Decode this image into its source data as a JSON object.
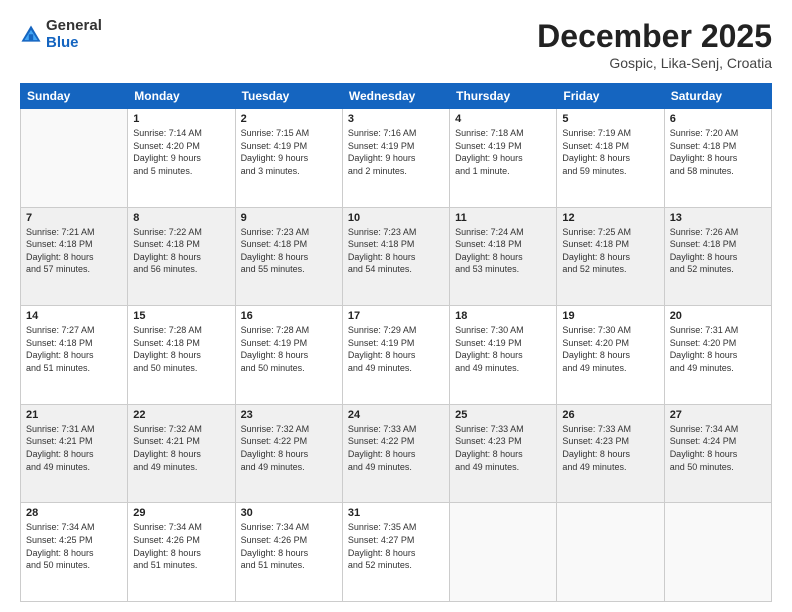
{
  "header": {
    "logo": {
      "general": "General",
      "blue": "Blue"
    },
    "title": "December 2025",
    "location": "Gospic, Lika-Senj, Croatia"
  },
  "weekdays": [
    "Sunday",
    "Monday",
    "Tuesday",
    "Wednesday",
    "Thursday",
    "Friday",
    "Saturday"
  ],
  "weeks": [
    [
      {
        "day": "",
        "info": ""
      },
      {
        "day": "1",
        "info": "Sunrise: 7:14 AM\nSunset: 4:20 PM\nDaylight: 9 hours\nand 5 minutes."
      },
      {
        "day": "2",
        "info": "Sunrise: 7:15 AM\nSunset: 4:19 PM\nDaylight: 9 hours\nand 3 minutes."
      },
      {
        "day": "3",
        "info": "Sunrise: 7:16 AM\nSunset: 4:19 PM\nDaylight: 9 hours\nand 2 minutes."
      },
      {
        "day": "4",
        "info": "Sunrise: 7:18 AM\nSunset: 4:19 PM\nDaylight: 9 hours\nand 1 minute."
      },
      {
        "day": "5",
        "info": "Sunrise: 7:19 AM\nSunset: 4:18 PM\nDaylight: 8 hours\nand 59 minutes."
      },
      {
        "day": "6",
        "info": "Sunrise: 7:20 AM\nSunset: 4:18 PM\nDaylight: 8 hours\nand 58 minutes."
      }
    ],
    [
      {
        "day": "7",
        "info": "Sunrise: 7:21 AM\nSunset: 4:18 PM\nDaylight: 8 hours\nand 57 minutes."
      },
      {
        "day": "8",
        "info": "Sunrise: 7:22 AM\nSunset: 4:18 PM\nDaylight: 8 hours\nand 56 minutes."
      },
      {
        "day": "9",
        "info": "Sunrise: 7:23 AM\nSunset: 4:18 PM\nDaylight: 8 hours\nand 55 minutes."
      },
      {
        "day": "10",
        "info": "Sunrise: 7:23 AM\nSunset: 4:18 PM\nDaylight: 8 hours\nand 54 minutes."
      },
      {
        "day": "11",
        "info": "Sunrise: 7:24 AM\nSunset: 4:18 PM\nDaylight: 8 hours\nand 53 minutes."
      },
      {
        "day": "12",
        "info": "Sunrise: 7:25 AM\nSunset: 4:18 PM\nDaylight: 8 hours\nand 52 minutes."
      },
      {
        "day": "13",
        "info": "Sunrise: 7:26 AM\nSunset: 4:18 PM\nDaylight: 8 hours\nand 52 minutes."
      }
    ],
    [
      {
        "day": "14",
        "info": "Sunrise: 7:27 AM\nSunset: 4:18 PM\nDaylight: 8 hours\nand 51 minutes."
      },
      {
        "day": "15",
        "info": "Sunrise: 7:28 AM\nSunset: 4:18 PM\nDaylight: 8 hours\nand 50 minutes."
      },
      {
        "day": "16",
        "info": "Sunrise: 7:28 AM\nSunset: 4:19 PM\nDaylight: 8 hours\nand 50 minutes."
      },
      {
        "day": "17",
        "info": "Sunrise: 7:29 AM\nSunset: 4:19 PM\nDaylight: 8 hours\nand 49 minutes."
      },
      {
        "day": "18",
        "info": "Sunrise: 7:30 AM\nSunset: 4:19 PM\nDaylight: 8 hours\nand 49 minutes."
      },
      {
        "day": "19",
        "info": "Sunrise: 7:30 AM\nSunset: 4:20 PM\nDaylight: 8 hours\nand 49 minutes."
      },
      {
        "day": "20",
        "info": "Sunrise: 7:31 AM\nSunset: 4:20 PM\nDaylight: 8 hours\nand 49 minutes."
      }
    ],
    [
      {
        "day": "21",
        "info": "Sunrise: 7:31 AM\nSunset: 4:21 PM\nDaylight: 8 hours\nand 49 minutes."
      },
      {
        "day": "22",
        "info": "Sunrise: 7:32 AM\nSunset: 4:21 PM\nDaylight: 8 hours\nand 49 minutes."
      },
      {
        "day": "23",
        "info": "Sunrise: 7:32 AM\nSunset: 4:22 PM\nDaylight: 8 hours\nand 49 minutes."
      },
      {
        "day": "24",
        "info": "Sunrise: 7:33 AM\nSunset: 4:22 PM\nDaylight: 8 hours\nand 49 minutes."
      },
      {
        "day": "25",
        "info": "Sunrise: 7:33 AM\nSunset: 4:23 PM\nDaylight: 8 hours\nand 49 minutes."
      },
      {
        "day": "26",
        "info": "Sunrise: 7:33 AM\nSunset: 4:23 PM\nDaylight: 8 hours\nand 49 minutes."
      },
      {
        "day": "27",
        "info": "Sunrise: 7:34 AM\nSunset: 4:24 PM\nDaylight: 8 hours\nand 50 minutes."
      }
    ],
    [
      {
        "day": "28",
        "info": "Sunrise: 7:34 AM\nSunset: 4:25 PM\nDaylight: 8 hours\nand 50 minutes."
      },
      {
        "day": "29",
        "info": "Sunrise: 7:34 AM\nSunset: 4:26 PM\nDaylight: 8 hours\nand 51 minutes."
      },
      {
        "day": "30",
        "info": "Sunrise: 7:34 AM\nSunset: 4:26 PM\nDaylight: 8 hours\nand 51 minutes."
      },
      {
        "day": "31",
        "info": "Sunrise: 7:35 AM\nSunset: 4:27 PM\nDaylight: 8 hours\nand 52 minutes."
      },
      {
        "day": "",
        "info": ""
      },
      {
        "day": "",
        "info": ""
      },
      {
        "day": "",
        "info": ""
      }
    ]
  ]
}
